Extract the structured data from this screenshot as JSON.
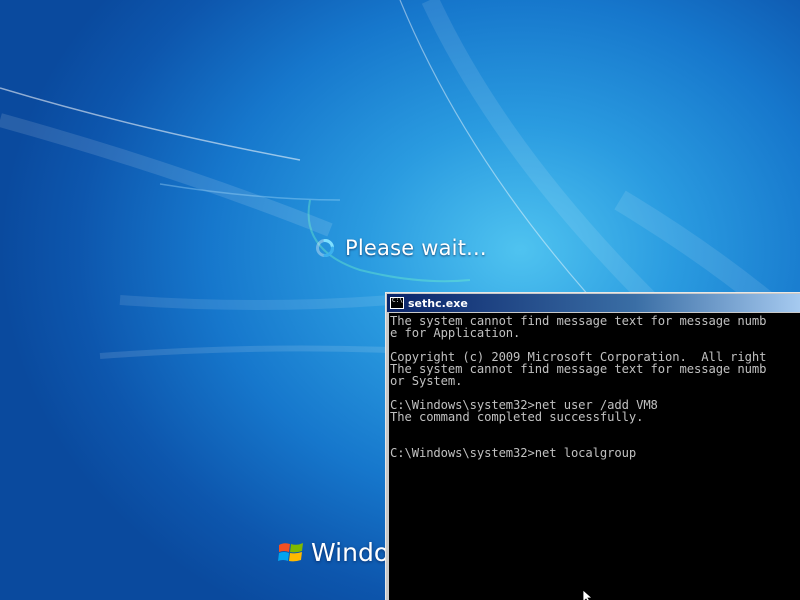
{
  "loading": {
    "message": "Please wait...",
    "spinner_icon": "loading-spinner-icon"
  },
  "branding": {
    "logo_icon": "windows-flag-icon",
    "text": "Windo"
  },
  "console": {
    "title": "sethc.exe",
    "icon": "cmd-icon",
    "lines": [
      "The system cannot find message text for message numb",
      "e for Application.",
      "",
      "Copyright (c) 2009 Microsoft Corporation.  All right",
      "The system cannot find message text for message numb",
      "or System.",
      "",
      "C:\\Windows\\system32>net user /add VM8",
      "The command completed successfully.",
      "",
      "",
      "C:\\Windows\\system32>net localgroup"
    ],
    "text_color": "#c0c0c0",
    "background": "#000000"
  },
  "colors": {
    "desktop_blue": "#1677cc",
    "titlebar_start": "#0a246a",
    "titlebar_end": "#a6caf0"
  },
  "cursor": {
    "icon": "mouse-pointer-icon"
  }
}
